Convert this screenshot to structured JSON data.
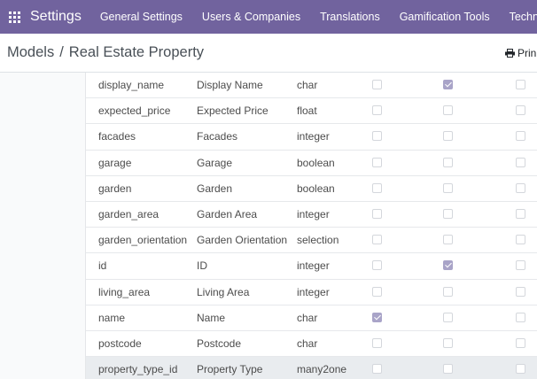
{
  "navbar": {
    "brand": "Settings",
    "menu": [
      "General Settings",
      "Users & Companies",
      "Translations",
      "Gamification Tools",
      "Technical"
    ]
  },
  "breadcrumb": {
    "parent": "Models",
    "separator": "/",
    "current": "Real Estate Property"
  },
  "actions": {
    "print_label": "Prin"
  },
  "colors": {
    "navbar": "#71639e",
    "checkbox_checked": "#a9a4c8",
    "row_highlight": "#e9ecef"
  },
  "fields": {
    "rows": [
      {
        "name": "display_name",
        "description": "Display Name",
        "type": "char",
        "required": false,
        "readonly": true,
        "indexed": false
      },
      {
        "name": "expected_price",
        "description": "Expected Price",
        "type": "float",
        "required": false,
        "readonly": false,
        "indexed": false
      },
      {
        "name": "facades",
        "description": "Facades",
        "type": "integer",
        "required": false,
        "readonly": false,
        "indexed": false
      },
      {
        "name": "garage",
        "description": "Garage",
        "type": "boolean",
        "required": false,
        "readonly": false,
        "indexed": false
      },
      {
        "name": "garden",
        "description": "Garden",
        "type": "boolean",
        "required": false,
        "readonly": false,
        "indexed": false
      },
      {
        "name": "garden_area",
        "description": "Garden Area",
        "type": "integer",
        "required": false,
        "readonly": false,
        "indexed": false
      },
      {
        "name": "garden_orientation",
        "description": "Garden Orientation",
        "type": "selection",
        "required": false,
        "readonly": false,
        "indexed": false
      },
      {
        "name": "id",
        "description": "ID",
        "type": "integer",
        "required": false,
        "readonly": true,
        "indexed": false
      },
      {
        "name": "living_area",
        "description": "Living Area",
        "type": "integer",
        "required": false,
        "readonly": false,
        "indexed": false
      },
      {
        "name": "name",
        "description": "Name",
        "type": "char",
        "required": true,
        "readonly": false,
        "indexed": false
      },
      {
        "name": "postcode",
        "description": "Postcode",
        "type": "char",
        "required": false,
        "readonly": false,
        "indexed": false
      },
      {
        "name": "property_type_id",
        "description": "Property Type",
        "type": "many2one",
        "required": false,
        "readonly": false,
        "indexed": false,
        "highlighted": true
      }
    ]
  }
}
